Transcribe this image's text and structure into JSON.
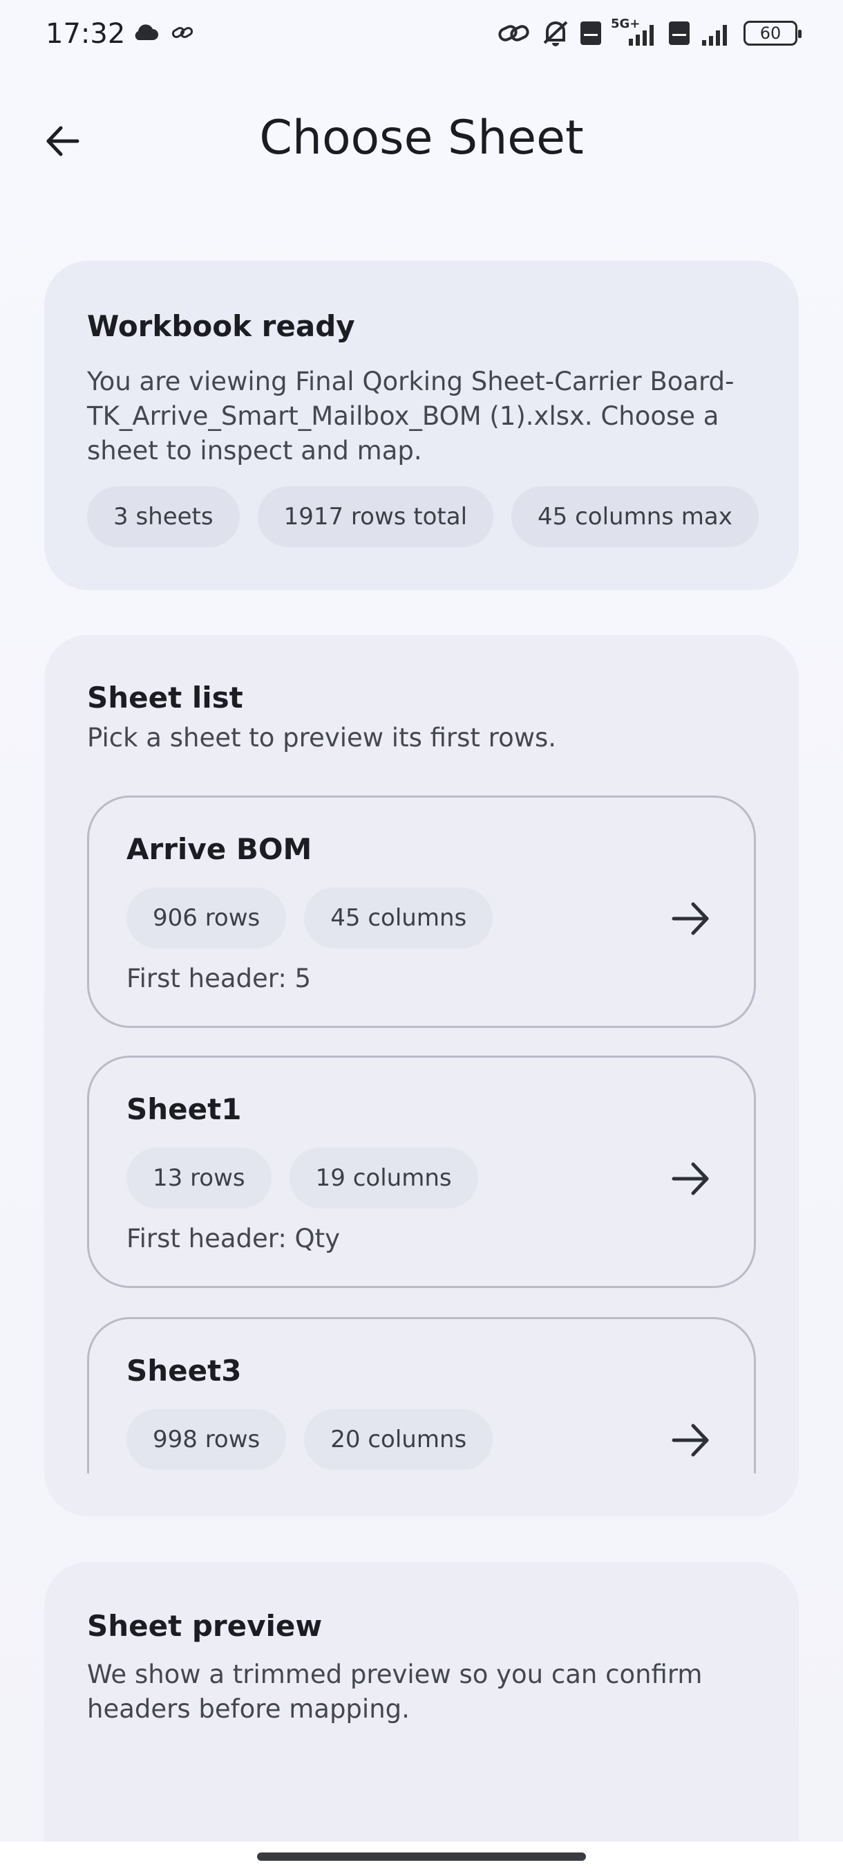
{
  "status_bar": {
    "time": "17:32",
    "battery": "60",
    "icons": [
      "cloud-icon",
      "link-icon",
      "hotspot-icon",
      "mute-icon",
      "volte-nr-icon",
      "signal-5g-icon",
      "volte-lte-icon",
      "signal-icon",
      "battery-icon"
    ],
    "network_label": "5G+"
  },
  "app_bar": {
    "title": "Choose Sheet",
    "back_icon": "arrow-back-icon"
  },
  "summary": {
    "title": "Workbook ready",
    "body": "You are viewing Final Qorking Sheet-Carrier Board-TK_Arrive_Smart_Mailbox_BOM (1).xlsx. Choose a sheet to inspect and map.",
    "chips": [
      "3 sheets",
      "1917 rows total",
      "45 columns max"
    ]
  },
  "sheet_list": {
    "title": "Sheet list",
    "subtitle": "Pick a sheet to preview its first rows.",
    "items": [
      {
        "name": "Arrive BOM",
        "rows": "906 rows",
        "columns": "45 columns",
        "header": "First header: 5"
      },
      {
        "name": "Sheet1",
        "rows": "13 rows",
        "columns": "19 columns",
        "header": "First header: Qty"
      },
      {
        "name": "Sheet3",
        "rows": "998 rows",
        "columns": "20 columns",
        "header": ""
      }
    ]
  },
  "preview": {
    "title": "Sheet preview",
    "body": "We show a trimmed preview so you can confirm headers before mapping."
  },
  "colors": {
    "background": "#f6f7fc",
    "card": "#e9ecf5",
    "chip": "#dfe2ec",
    "border": "#b9bbc6",
    "text": "#1d1e24"
  }
}
